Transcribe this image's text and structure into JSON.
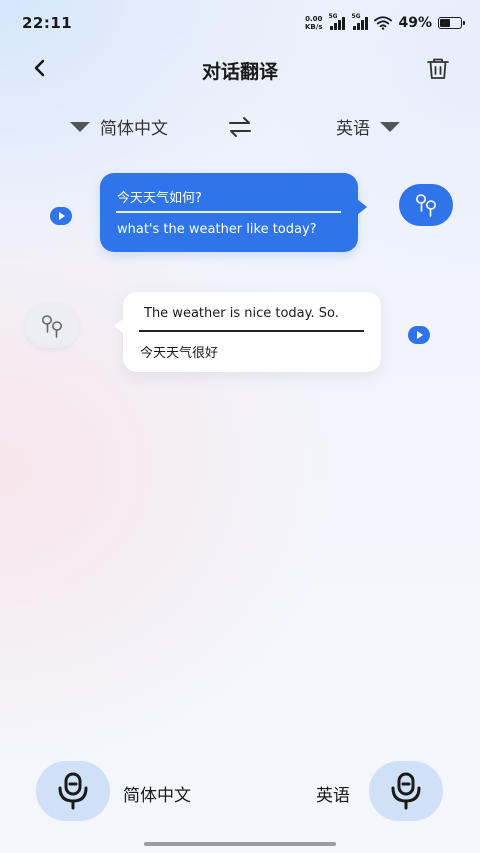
{
  "status_bar": {
    "time": "22:11",
    "net_speed_value": "0.00",
    "net_speed_unit": "KB/s",
    "signal1_label": "5G",
    "signal2_label": "5G",
    "battery_text": "49%",
    "battery_level": 0.49
  },
  "header": {
    "title": "对话翻译",
    "back_icon": "chevron-left-icon",
    "trash_icon": "trash-icon"
  },
  "language_selector": {
    "source_language": "简体中文",
    "target_language": "英语",
    "swap_icon": "swap-arrows-icon"
  },
  "conversation": [
    {
      "speaker": "self",
      "original": "今天天气如何?",
      "translation": "what's the weather like today?",
      "bubble_color": "#2f74e8"
    },
    {
      "speaker": "other",
      "original": "The weather is nice today. So.",
      "translation": "今天天气很好",
      "bubble_color": "#ffffff"
    }
  ],
  "bottom_bar": {
    "left_mic_label": "简体中文",
    "right_mic_label": "英语",
    "mic_button_color": "#cfe0f7"
  },
  "colors": {
    "accent": "#2f74e8"
  }
}
